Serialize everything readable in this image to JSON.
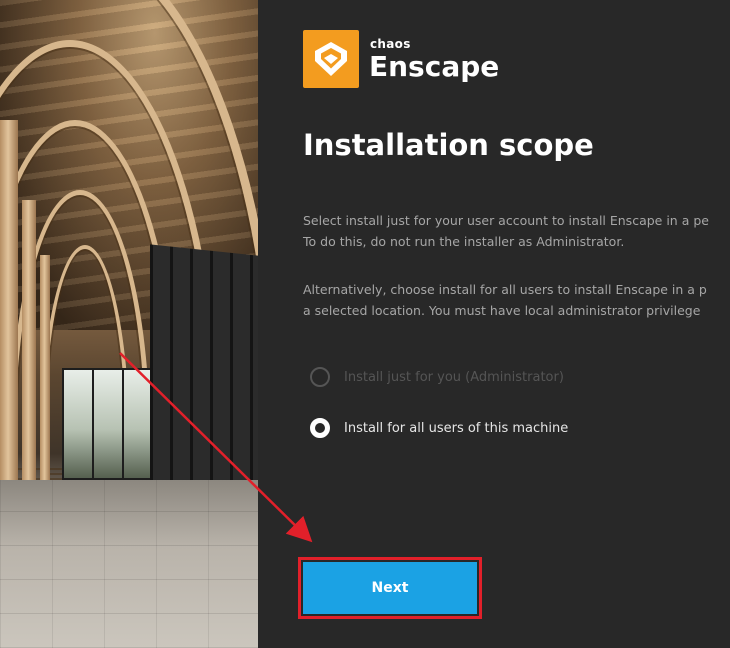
{
  "logo": {
    "brand": "chaos",
    "product": "Enscape",
    "icon": "enscape-logo-icon",
    "accent_color": "#f39c1f"
  },
  "page": {
    "title": "Installation scope",
    "paragraph1": {
      "line1": "Select install just for your user account to install Enscape in a pe",
      "line2": "To do this, do not run the installer as Administrator."
    },
    "paragraph2": {
      "line1": "Alternatively, choose install for all users to install Enscape in a p",
      "line2": "a selected location. You must have local administrator privilege"
    }
  },
  "options": [
    {
      "label": "Install just for you (Administrator)",
      "state": "disabled"
    },
    {
      "label": "Install for all users of this machine",
      "state": "selected"
    }
  ],
  "actions": {
    "next_label": "Next",
    "button_color": "#1ba2e4",
    "highlight_color": "#e2202a"
  }
}
